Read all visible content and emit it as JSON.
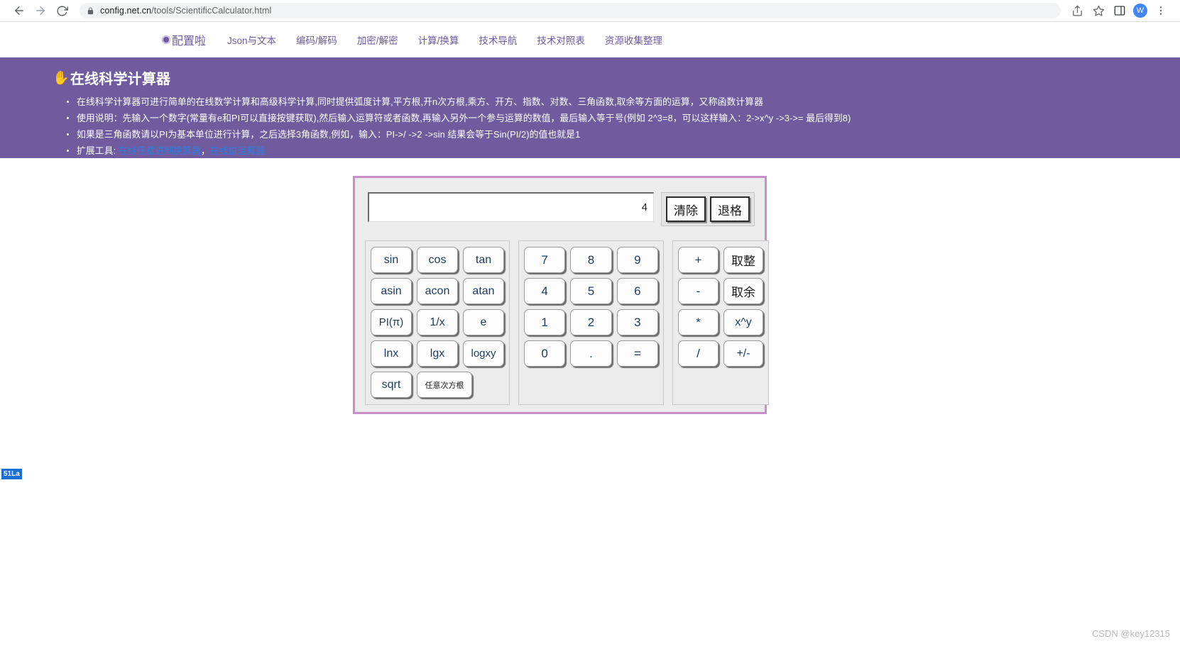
{
  "browser": {
    "back_icon": "back-arrow-icon",
    "forward_icon": "forward-arrow-icon",
    "reload_icon": "reload-icon",
    "lock_icon": "lock-icon",
    "url_host": "config.net.cn",
    "url_path": "/tools/ScientificCalculator.html",
    "share_icon": "share-icon",
    "bookmark_icon": "star-icon",
    "sidebar_icon": "sidebar-icon",
    "avatar_letter": "W",
    "menu_icon": "kebab-menu-icon"
  },
  "site_nav": {
    "brand": "配置啦",
    "links": [
      "Json与文本",
      "编码/解码",
      "加密/解密",
      "计算/换算",
      "技术导航",
      "技术对照表",
      "资源收集整理"
    ]
  },
  "hero": {
    "title": "在线科学计算器",
    "title_icon": "hand-pointing-icon",
    "bullets": [
      "在线科学计算器可进行简单的在线数学计算和高级科学计算,同时提供弧度计算,平方根,开n次方根,乘方、开方、指数、对数、三角函数,取余等方面的运算，又称函数计算器",
      "使用说明：先输入一个数字(常量有e和PI可以直接按键获取),然后输入运算符或者函数,再输入另外一个参与运算的数值，最后输入等于号(例如 2^3=8，可以这样输入：2->x^y ->3->= 最后得到8)",
      "如果是三角函数请以PI为基本单位进行计算，之后选择3角函数,例如，输入：PI->/ ->2 ->sin 结果会等于Sin(PI/2)的值也就是1"
    ],
    "tools_label": "扩展工具:",
    "tool_links": [
      "在线任意进制换算器",
      "在线位运算器"
    ],
    "tool_separator": "，",
    "bg_color": "#6f5b9e",
    "link_color": "#2b7fe0"
  },
  "calculator": {
    "display_value": "4",
    "clear_label": "清除",
    "backspace_label": "退格",
    "border_color": "#c98fc9",
    "function_pad": [
      [
        "sin",
        "cos",
        "tan"
      ],
      [
        "asin",
        "acon",
        "atan"
      ],
      [
        "PI(π)",
        "1/x",
        "e"
      ],
      [
        "lnx",
        "lgx",
        "logxy"
      ],
      [
        "sqrt",
        "任意次方根"
      ]
    ],
    "number_pad": [
      [
        "7",
        "8",
        "9"
      ],
      [
        "4",
        "5",
        "6"
      ],
      [
        "1",
        "2",
        "3"
      ],
      [
        "0",
        ".",
        "="
      ]
    ],
    "operator_pad": [
      [
        "+",
        "取整"
      ],
      [
        "-",
        "取余"
      ],
      [
        "*",
        "x^y"
      ],
      [
        "/",
        "+/-"
      ]
    ]
  },
  "footer": {
    "la_badge": "51La",
    "watermark": "CSDN @key12315"
  }
}
